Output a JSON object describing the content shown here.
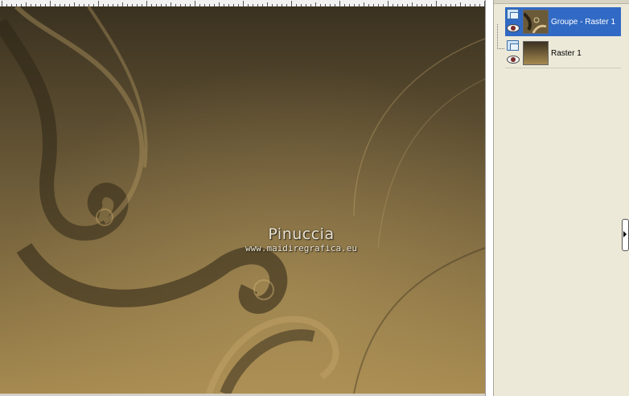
{
  "canvas": {
    "watermark_title": "Pinuccia",
    "watermark_url": "www.maidiregrafica.eu",
    "colors": {
      "dark": "#3b3221",
      "mid": "#7a6844",
      "light": "#a68a50"
    }
  },
  "layers": {
    "items": [
      {
        "name": "Groupe - Raster 1",
        "selected": true
      },
      {
        "name": "Raster 1",
        "selected": false
      }
    ],
    "colors": {
      "selected_bg": "#316ac5",
      "panel_bg": "#ece9d8"
    }
  }
}
